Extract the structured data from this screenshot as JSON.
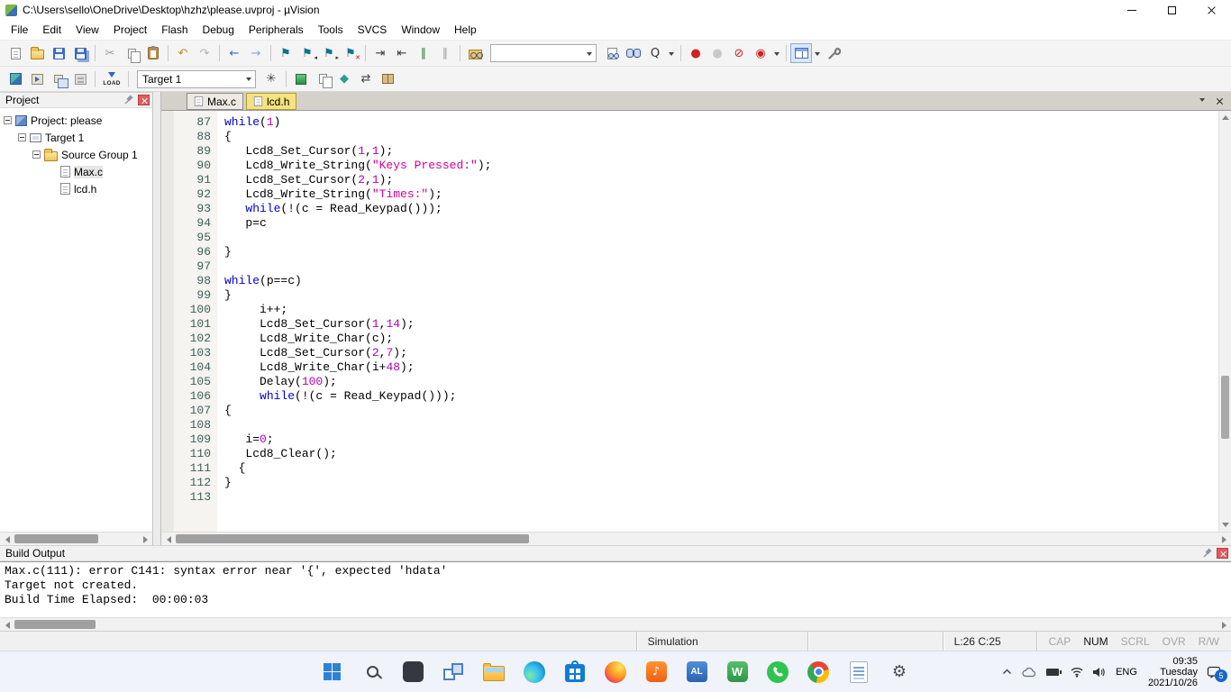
{
  "window": {
    "title": "C:\\Users\\sello\\OneDrive\\Desktop\\hzhz\\please.uvproj - µVision"
  },
  "menu": {
    "items": [
      "File",
      "Edit",
      "View",
      "Project",
      "Flash",
      "Debug",
      "Peripherals",
      "Tools",
      "SVCS",
      "Window",
      "Help"
    ]
  },
  "toolbar_main": [
    {
      "type": "icon",
      "name": "new-file-icon",
      "shape": "page"
    },
    {
      "type": "icon",
      "name": "open-file-icon",
      "shape": "folder"
    },
    {
      "type": "icon",
      "name": "save-icon",
      "shape": "floppy"
    },
    {
      "type": "icon",
      "name": "save-all-icon",
      "shape": "floppy-all"
    },
    {
      "type": "sep"
    },
    {
      "type": "icon",
      "name": "cut-icon",
      "glyph": "✂",
      "color": "#9a9aa6"
    },
    {
      "type": "icon",
      "name": "copy-icon",
      "shape": "copy"
    },
    {
      "type": "icon",
      "name": "paste-icon",
      "shape": "clipboard"
    },
    {
      "type": "sep"
    },
    {
      "type": "icon",
      "name": "undo-icon",
      "glyph": "↶",
      "color": "#c78a1e"
    },
    {
      "type": "icon",
      "name": "redo-icon",
      "glyph": "↷",
      "color": "#b3b3b3"
    },
    {
      "type": "sep"
    },
    {
      "type": "icon",
      "name": "navigate-back-icon",
      "glyph": "←",
      "color": "#2f6fc0"
    },
    {
      "type": "icon",
      "name": "navigate-forward-icon",
      "glyph": "→",
      "color": "#7fa6d8"
    },
    {
      "type": "sep"
    },
    {
      "type": "icon",
      "name": "toggle-bookmark-icon",
      "glyph": "⚑",
      "color": "#0f7490"
    },
    {
      "type": "icon",
      "name": "previous-bookmark-icon",
      "glyph": "⚑",
      "color": "#0f7490",
      "badge": "◂",
      "badge_color": "#333"
    },
    {
      "type": "icon",
      "name": "next-bookmark-icon",
      "glyph": "⚑",
      "color": "#0f7490",
      "badge": "▸",
      "badge_color": "#333"
    },
    {
      "type": "icon",
      "name": "clear-bookmarks-icon",
      "glyph": "⚑",
      "color": "#0f7490",
      "badge": "✕",
      "badge_color": "#c00"
    },
    {
      "type": "sep"
    },
    {
      "type": "icon",
      "name": "indent-icon",
      "glyph": "⇥",
      "color": "#3a3a3a"
    },
    {
      "type": "icon",
      "name": "unindent-icon",
      "glyph": "⇤",
      "color": "#3a3a3a"
    },
    {
      "type": "icon",
      "name": "comment-icon",
      "glyph": "∥",
      "color": "#2e7d32"
    },
    {
      "type": "icon",
      "name": "uncomment-icon",
      "glyph": "∥",
      "color": "#9e9e9e"
    },
    {
      "type": "sep"
    },
    {
      "type": "icon",
      "name": "find-in-files-icon",
      "shape": "find-folder"
    },
    {
      "type": "combo",
      "name": "find-text-combo",
      "value": "",
      "width": 118
    },
    {
      "type": "icon",
      "name": "search-in-document-icon",
      "shape": "page-binoc"
    },
    {
      "type": "icon",
      "name": "find-icon",
      "shape": "binoc"
    },
    {
      "type": "icon",
      "name": "incremental-find-icon",
      "glyph": "Q",
      "color": "#333"
    },
    {
      "type": "dropdown",
      "name": "find-options-dropdown"
    },
    {
      "type": "sep"
    },
    {
      "type": "icon",
      "name": "insert-breakpoint-icon",
      "glyph": "●",
      "color": "#d22222"
    },
    {
      "type": "icon",
      "name": "enable-disable-breakpoint-icon",
      "glyph": "●",
      "color": "#c9c9c9"
    },
    {
      "type": "icon",
      "name": "kill-all-breakpoints-icon",
      "glyph": "⊘",
      "color": "#d22222"
    },
    {
      "type": "icon",
      "name": "breakpoint-options-icon",
      "glyph": "◉",
      "color": "#d22222"
    },
    {
      "type": "dropdown",
      "name": "breakpoint-dropdown"
    },
    {
      "type": "sep"
    },
    {
      "type": "icon",
      "name": "debug-windows-icon",
      "shape": "grid",
      "boxed": true
    },
    {
      "type": "dropdown",
      "name": "debug-windows-dropdown"
    },
    {
      "type": "icon",
      "name": "configure-tools-icon",
      "shape": "wrench"
    }
  ],
  "toolbar_build": [
    {
      "type": "icon",
      "name": "translate-file-icon",
      "shape": "translate"
    },
    {
      "type": "icon",
      "name": "build-icon",
      "shape": "build"
    },
    {
      "type": "icon",
      "name": "rebuild-all-icon",
      "shape": "rebuild"
    },
    {
      "type": "icon",
      "name": "batch-build-icon",
      "shape": "batch"
    },
    {
      "type": "sep"
    },
    {
      "type": "icon",
      "name": "download-icon",
      "shape": "load",
      "label": "LOAD",
      "stack": true
    },
    {
      "type": "sep"
    },
    {
      "type": "combo",
      "name": "target-select-combo",
      "value": "Target 1",
      "width": 132
    },
    {
      "type": "icon",
      "name": "options-for-target-icon",
      "glyph": "✳",
      "color": "#444"
    },
    {
      "type": "sep"
    },
    {
      "type": "icon",
      "name": "manage-run-time-environment-icon",
      "shape": "cube-green"
    },
    {
      "type": "icon",
      "name": "file-extensions-icon",
      "shape": "pages"
    },
    {
      "type": "icon",
      "name": "books-icon",
      "glyph": "◆",
      "color": "#2a9d8f"
    },
    {
      "type": "icon",
      "name": "select-software-packs-icon",
      "glyph": "⇄",
      "color": "#444"
    },
    {
      "type": "icon",
      "name": "pack-installer-icon",
      "shape": "package"
    }
  ],
  "project_panel": {
    "title": "Project",
    "tree": [
      {
        "label": "Project: please",
        "level": 0,
        "expanded": true,
        "icon": "project-icon"
      },
      {
        "label": "Target 1",
        "level": 1,
        "expanded": true,
        "icon": "target-icon"
      },
      {
        "label": "Source Group 1",
        "level": 2,
        "expanded": true,
        "icon": "source-group-folder-icon"
      },
      {
        "label": "Max.c",
        "level": 3,
        "icon": "c-file-icon",
        "selected": true
      },
      {
        "label": "lcd.h",
        "level": 3,
        "icon": "h-file-icon"
      }
    ]
  },
  "editor": {
    "tabs": [
      {
        "label": "Max.c",
        "active": false
      },
      {
        "label": "lcd.h",
        "active": true
      }
    ],
    "colors": {
      "keyword": "#0000d2",
      "string": "#d60095",
      "number": "#b400b4",
      "line_number": "#3d6158"
    },
    "lines": [
      {
        "n": 87,
        "seg": [
          [
            "k",
            "while"
          ],
          [
            "p",
            "("
          ],
          [
            "n",
            "1"
          ],
          [
            "p",
            ")"
          ]
        ]
      },
      {
        "n": 88,
        "seg": [
          [
            "p",
            "{"
          ]
        ]
      },
      {
        "n": 89,
        "seg": [
          [
            "p",
            "   Lcd8_Set_Cursor("
          ],
          [
            "n",
            "1"
          ],
          [
            "p",
            ","
          ],
          [
            "n",
            "1"
          ],
          [
            "p",
            ");"
          ]
        ]
      },
      {
        "n": 90,
        "seg": [
          [
            "p",
            "   Lcd8_Write_String("
          ],
          [
            "s",
            "\"Keys Pressed:\""
          ],
          [
            "p",
            ");"
          ]
        ]
      },
      {
        "n": 91,
        "seg": [
          [
            "p",
            "   Lcd8_Set_Cursor("
          ],
          [
            "n",
            "2"
          ],
          [
            "p",
            ","
          ],
          [
            "n",
            "1"
          ],
          [
            "p",
            ");"
          ]
        ]
      },
      {
        "n": 92,
        "seg": [
          [
            "p",
            "   Lcd8_Write_String("
          ],
          [
            "s",
            "\"Times:\""
          ],
          [
            "p",
            ");"
          ]
        ]
      },
      {
        "n": 93,
        "seg": [
          [
            "p",
            "   "
          ],
          [
            "k",
            "while"
          ],
          [
            "p",
            "(!(c = Read_Keypad()));"
          ]
        ]
      },
      {
        "n": 94,
        "seg": [
          [
            "p",
            "   p=c"
          ]
        ]
      },
      {
        "n": 95,
        "seg": []
      },
      {
        "n": 96,
        "seg": [
          [
            "p",
            "}"
          ]
        ]
      },
      {
        "n": 97,
        "seg": []
      },
      {
        "n": 98,
        "seg": [
          [
            "k",
            "while"
          ],
          [
            "p",
            "(p==c)"
          ]
        ]
      },
      {
        "n": 99,
        "seg": [
          [
            "p",
            "}"
          ]
        ]
      },
      {
        "n": 100,
        "seg": [
          [
            "p",
            "     i++;"
          ]
        ]
      },
      {
        "n": 101,
        "seg": [
          [
            "p",
            "     Lcd8_Set_Cursor("
          ],
          [
            "n",
            "1"
          ],
          [
            "p",
            ","
          ],
          [
            "n",
            "14"
          ],
          [
            "p",
            ");"
          ]
        ]
      },
      {
        "n": 102,
        "seg": [
          [
            "p",
            "     Lcd8_Write_Char(c);"
          ]
        ]
      },
      {
        "n": 103,
        "seg": [
          [
            "p",
            "     Lcd8_Set_Cursor("
          ],
          [
            "n",
            "2"
          ],
          [
            "p",
            ","
          ],
          [
            "n",
            "7"
          ],
          [
            "p",
            ");"
          ]
        ]
      },
      {
        "n": 104,
        "seg": [
          [
            "p",
            "     Lcd8_Write_Char(i+"
          ],
          [
            "n",
            "48"
          ],
          [
            "p",
            ");"
          ]
        ]
      },
      {
        "n": 105,
        "seg": [
          [
            "p",
            "     Delay("
          ],
          [
            "n",
            "100"
          ],
          [
            "p",
            ");"
          ]
        ]
      },
      {
        "n": 106,
        "seg": [
          [
            "p",
            "     "
          ],
          [
            "k",
            "while"
          ],
          [
            "p",
            "(!(c = Read_Keypad()));"
          ]
        ]
      },
      {
        "n": 107,
        "seg": [
          [
            "p",
            "{"
          ]
        ]
      },
      {
        "n": 108,
        "seg": []
      },
      {
        "n": 109,
        "seg": [
          [
            "p",
            "   i="
          ],
          [
            "n",
            "0"
          ],
          [
            "p",
            ";"
          ]
        ]
      },
      {
        "n": 110,
        "seg": [
          [
            "p",
            "   Lcd8_Clear();"
          ]
        ]
      },
      {
        "n": 111,
        "seg": [
          [
            "p",
            "  {"
          ]
        ]
      },
      {
        "n": 112,
        "seg": [
          [
            "p",
            "}"
          ]
        ]
      },
      {
        "n": 113,
        "seg": []
      }
    ]
  },
  "build_output": {
    "title": "Build Output",
    "lines": [
      "Max.c(111): error C141: syntax error near '{', expected 'hdata'",
      "Target not created.",
      "Build Time Elapsed:  00:00:03"
    ]
  },
  "status_bar": {
    "mode": "Simulation",
    "cursor": "L:26 C:25",
    "indicators": [
      {
        "label": "CAP",
        "active": false
      },
      {
        "label": "NUM",
        "active": true
      },
      {
        "label": "SCRL",
        "active": false
      },
      {
        "label": "OVR",
        "active": false
      },
      {
        "label": "R/W",
        "active": false
      }
    ]
  },
  "taskbar": {
    "apps": [
      {
        "name": "start-button"
      },
      {
        "name": "search-button"
      },
      {
        "name": "terminal-app-icon"
      },
      {
        "name": "task-view-icon"
      },
      {
        "name": "file-explorer-icon"
      },
      {
        "name": "edge-browser-icon"
      },
      {
        "name": "microsoft-store-icon"
      },
      {
        "name": "firefox-icon"
      },
      {
        "name": "media-player-icon"
      },
      {
        "name": "photo-viewer-icon",
        "label": "AL"
      },
      {
        "name": "wps-office-icon",
        "label": "W"
      },
      {
        "name": "whatsapp-icon"
      },
      {
        "name": "chrome-icon"
      },
      {
        "name": "notepad-icon"
      },
      {
        "name": "settings-app-icon"
      }
    ],
    "tray": {
      "language": "ENG",
      "time": "09:35",
      "weekday": "Tuesday",
      "date": "2021/10/26",
      "notification_count": "5"
    }
  }
}
